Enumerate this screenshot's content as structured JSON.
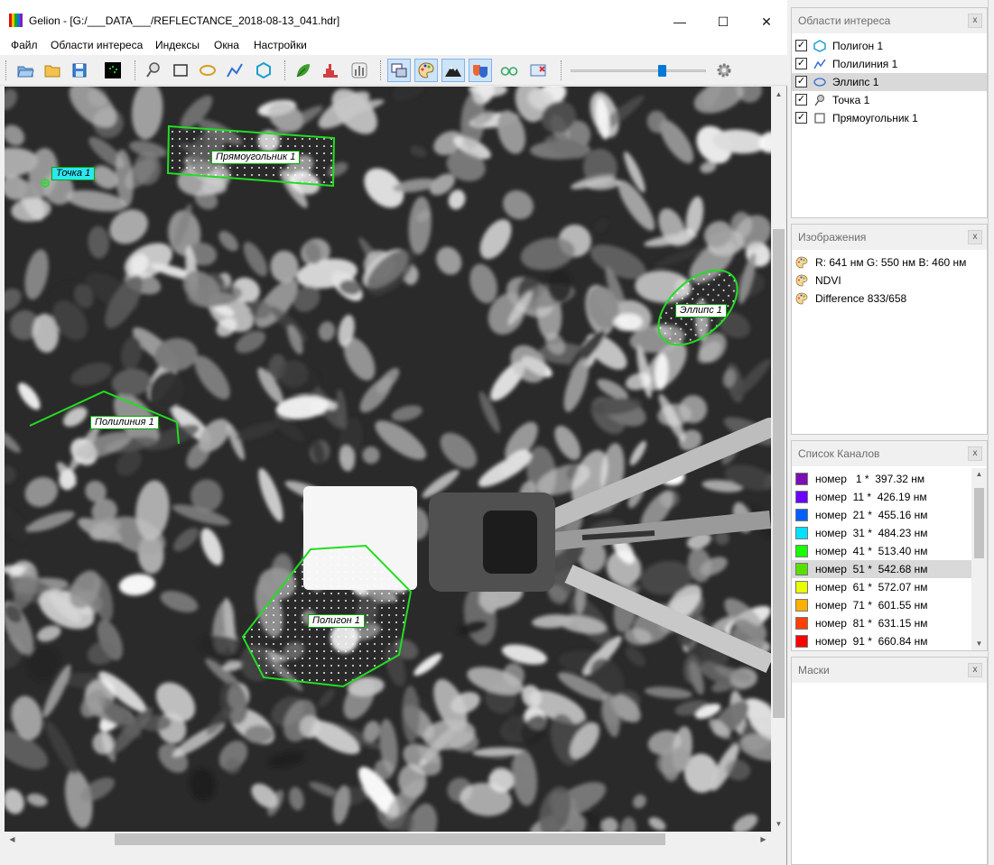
{
  "window": {
    "title": "Gelion - [G:/___DATA___/REFLECTANCE_2018-08-13_041.hdr]",
    "minimize": "—",
    "maximize": "☐",
    "close": "✕"
  },
  "menu": {
    "items": [
      "Файл",
      "Области интереса",
      "Индексы",
      "Окна",
      "Настройки"
    ]
  },
  "toolbar": {
    "buttons": [
      "open-icon",
      "folder-icon",
      "save-icon",
      "spectrum-view-icon",
      "point-tool-icon",
      "rectangle-tool-icon",
      "ellipse-tool-icon",
      "polyline-tool-icon",
      "polygon-tool-icon",
      "leaf-icon",
      "histogram-icon",
      "bar-chart-icon",
      "windows-icon",
      "palette-icon",
      "mountain-icon",
      "masks-icon",
      "glasses-icon",
      "screenshot-icon",
      "gear-icon"
    ],
    "zoom_level_fraction": 0.69
  },
  "canvas": {
    "roi_labels": {
      "rectangle": "Прямоугольник 1",
      "point": "Точка 1",
      "ellipse": "Эллипс 1",
      "polyline": "Полилиния 1",
      "polygon": "Полигон 1"
    },
    "roi_color": "#22dd22"
  },
  "panels": {
    "roi": {
      "title": "Области интереса",
      "close": "x",
      "items": [
        {
          "label": "Полигон 1",
          "icon": "polygon-icon",
          "checked": "✓"
        },
        {
          "label": "Полилиния 1",
          "icon": "polyline-icon",
          "checked": "✓"
        },
        {
          "label": "Эллипс 1",
          "icon": "ellipse-icon",
          "checked": "✓"
        },
        {
          "label": "Точка 1",
          "icon": "point-icon",
          "checked": "✓"
        },
        {
          "label": "Прямоугольник 1",
          "icon": "rectangle-icon",
          "checked": "✓"
        }
      ]
    },
    "images": {
      "title": "Изображения",
      "close": "x",
      "items": [
        {
          "label": "R: 641 нм G: 550 нм B: 460 нм",
          "icon": "palette-icon"
        },
        {
          "label": "NDVI",
          "icon": "palette-icon"
        },
        {
          "label": "Difference 833/658",
          "icon": "palette-icon"
        }
      ]
    },
    "channels": {
      "title": "Список Каналов",
      "close": "x",
      "items": [
        {
          "label": "номер   1 *  397.32 нм",
          "color": "#7a0fb4"
        },
        {
          "label": "номер  11 *  426.19 нм",
          "color": "#6a00ff"
        },
        {
          "label": "номер  21 *  455.16 нм",
          "color": "#0060ff"
        },
        {
          "label": "номер  31 *  484.23 нм",
          "color": "#00e0ff"
        },
        {
          "label": "номер  41 *  513.40 нм",
          "color": "#1aff00"
        },
        {
          "label": "номер  51 *  542.68 нм",
          "color": "#55e000"
        },
        {
          "label": "номер  61 *  572.07 нм",
          "color": "#e8ff00"
        },
        {
          "label": "номер  71 *  601.55 нм",
          "color": "#ffb000"
        },
        {
          "label": "номер  81 *  631.15 нм",
          "color": "#ff4000"
        },
        {
          "label": "номер  91 *  660.84 нм",
          "color": "#ff0000"
        }
      ]
    },
    "masks": {
      "title": "Маски",
      "close": "x"
    }
  }
}
